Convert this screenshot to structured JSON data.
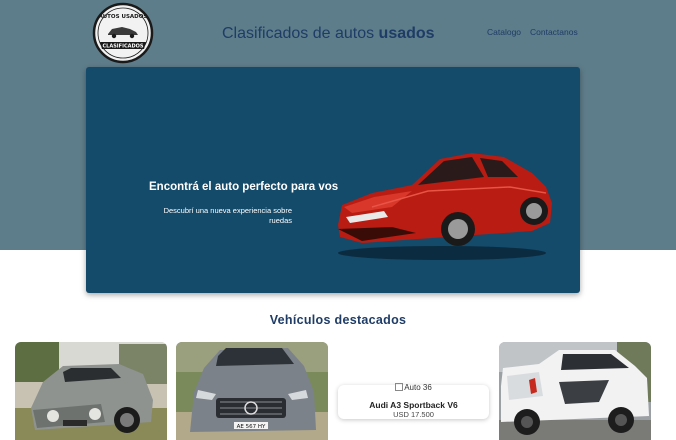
{
  "header": {
    "logo": {
      "top_text": "AUTOS USADOS",
      "banner_text": "CLASIFICADOS"
    },
    "title_prefix": "Clasificados de autos",
    "title_bold": "usados",
    "nav": [
      {
        "label": "Catalogo"
      },
      {
        "label": "Contactanos"
      }
    ]
  },
  "hero": {
    "title": "Encontrá el auto perfecto para vos",
    "subtitle": "Descubrí una nueva experiencia sobre ruedas"
  },
  "featured": {
    "title": "Vehículos destacados",
    "cards": [
      {
        "image": "silver-mini-cooper"
      },
      {
        "image": "grey-mercedes-suv",
        "plate": "AE 567 HY"
      },
      {
        "image_alt": "Auto 36",
        "name": "Audi A3 Sportback V6",
        "price": "USD 17.500"
      },
      {
        "image": "white-pickup-truck"
      }
    ]
  },
  "colors": {
    "band": "#5e7d8a",
    "hero": "#144a6a",
    "title_text": "#1e3c66"
  }
}
